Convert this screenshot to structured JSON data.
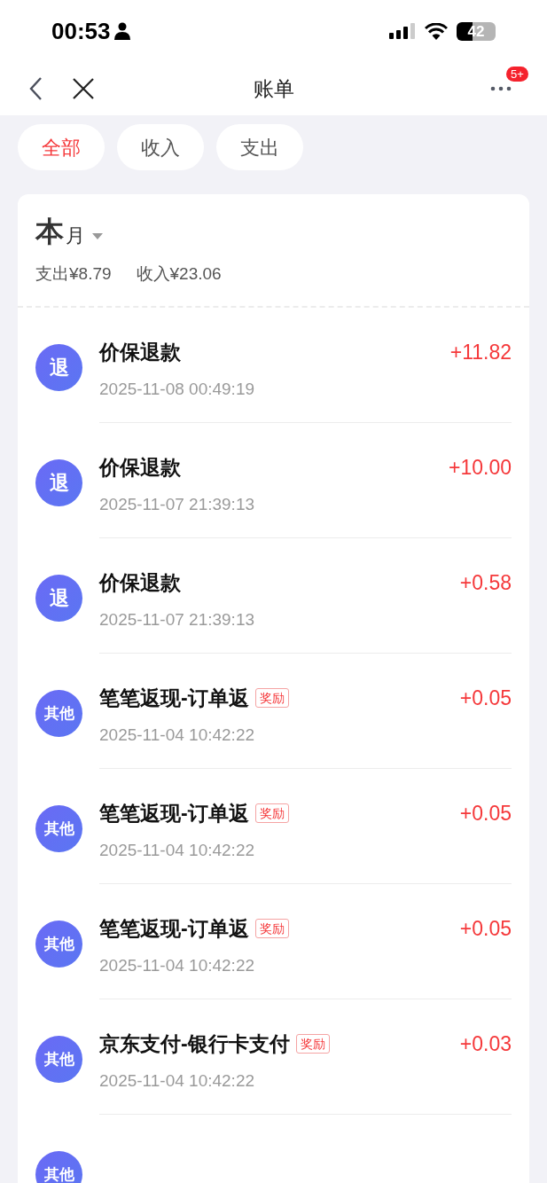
{
  "status_bar": {
    "time": "00:53",
    "battery": "42"
  },
  "nav": {
    "title": "账单",
    "badge": "5+"
  },
  "filters": [
    {
      "label": "全部",
      "selected": true
    },
    {
      "label": "收入",
      "selected": false
    },
    {
      "label": "支出",
      "selected": false
    }
  ],
  "period": {
    "big": "本",
    "small": "月",
    "expense": "支出¥8.79",
    "income": "收入¥23.06"
  },
  "records": [
    {
      "kind": "refund",
      "avatar": "退",
      "title": "价保退款",
      "date": "2025-11-08 00:49:19",
      "amount": "+11.82"
    },
    {
      "kind": "refund",
      "avatar": "退",
      "title": "价保退款",
      "date": "2025-11-07 21:39:13",
      "amount": "+10.00"
    },
    {
      "kind": "refund",
      "avatar": "退",
      "title": "价保退款",
      "date": "2025-11-07 21:39:13",
      "amount": "+0.58"
    },
    {
      "kind": "other",
      "avatar": "其他",
      "title": "笔笔返现-订单返",
      "tag": "奖励",
      "date": "2025-11-04 10:42:22",
      "amount": "+0.05"
    },
    {
      "kind": "other",
      "avatar": "其他",
      "title": "笔笔返现-订单返",
      "tag": "奖励",
      "date": "2025-11-04 10:42:22",
      "amount": "+0.05"
    },
    {
      "kind": "other",
      "avatar": "其他",
      "title": "笔笔返现-订单返",
      "tag": "奖励",
      "date": "2025-11-04 10:42:22",
      "amount": "+0.05"
    },
    {
      "kind": "other",
      "avatar": "其他",
      "title": "京东支付-银行卡支付",
      "tag": "奖励",
      "date": "2025-11-04 10:42:22",
      "amount": "+0.03"
    },
    {
      "kind": "other",
      "avatar": "其他"
    }
  ]
}
